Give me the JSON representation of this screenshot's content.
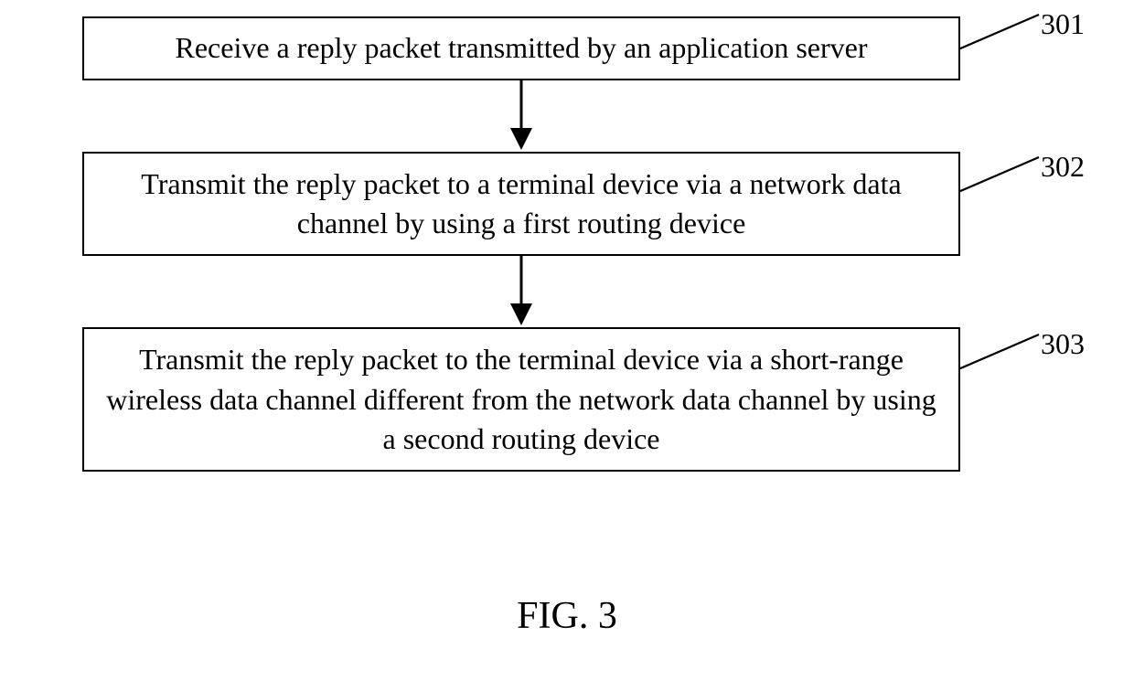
{
  "steps": {
    "s1": {
      "text": "Receive a reply packet transmitted by an application server",
      "ref": "301"
    },
    "s2": {
      "text": "Transmit the reply packet to a terminal device via a network data channel by using a first routing device",
      "ref": "302"
    },
    "s3": {
      "text": "Transmit the reply packet to the terminal device via a short-range wireless data channel different from the network data channel by using a second routing device",
      "ref": "303"
    }
  },
  "caption": "FIG. 3"
}
